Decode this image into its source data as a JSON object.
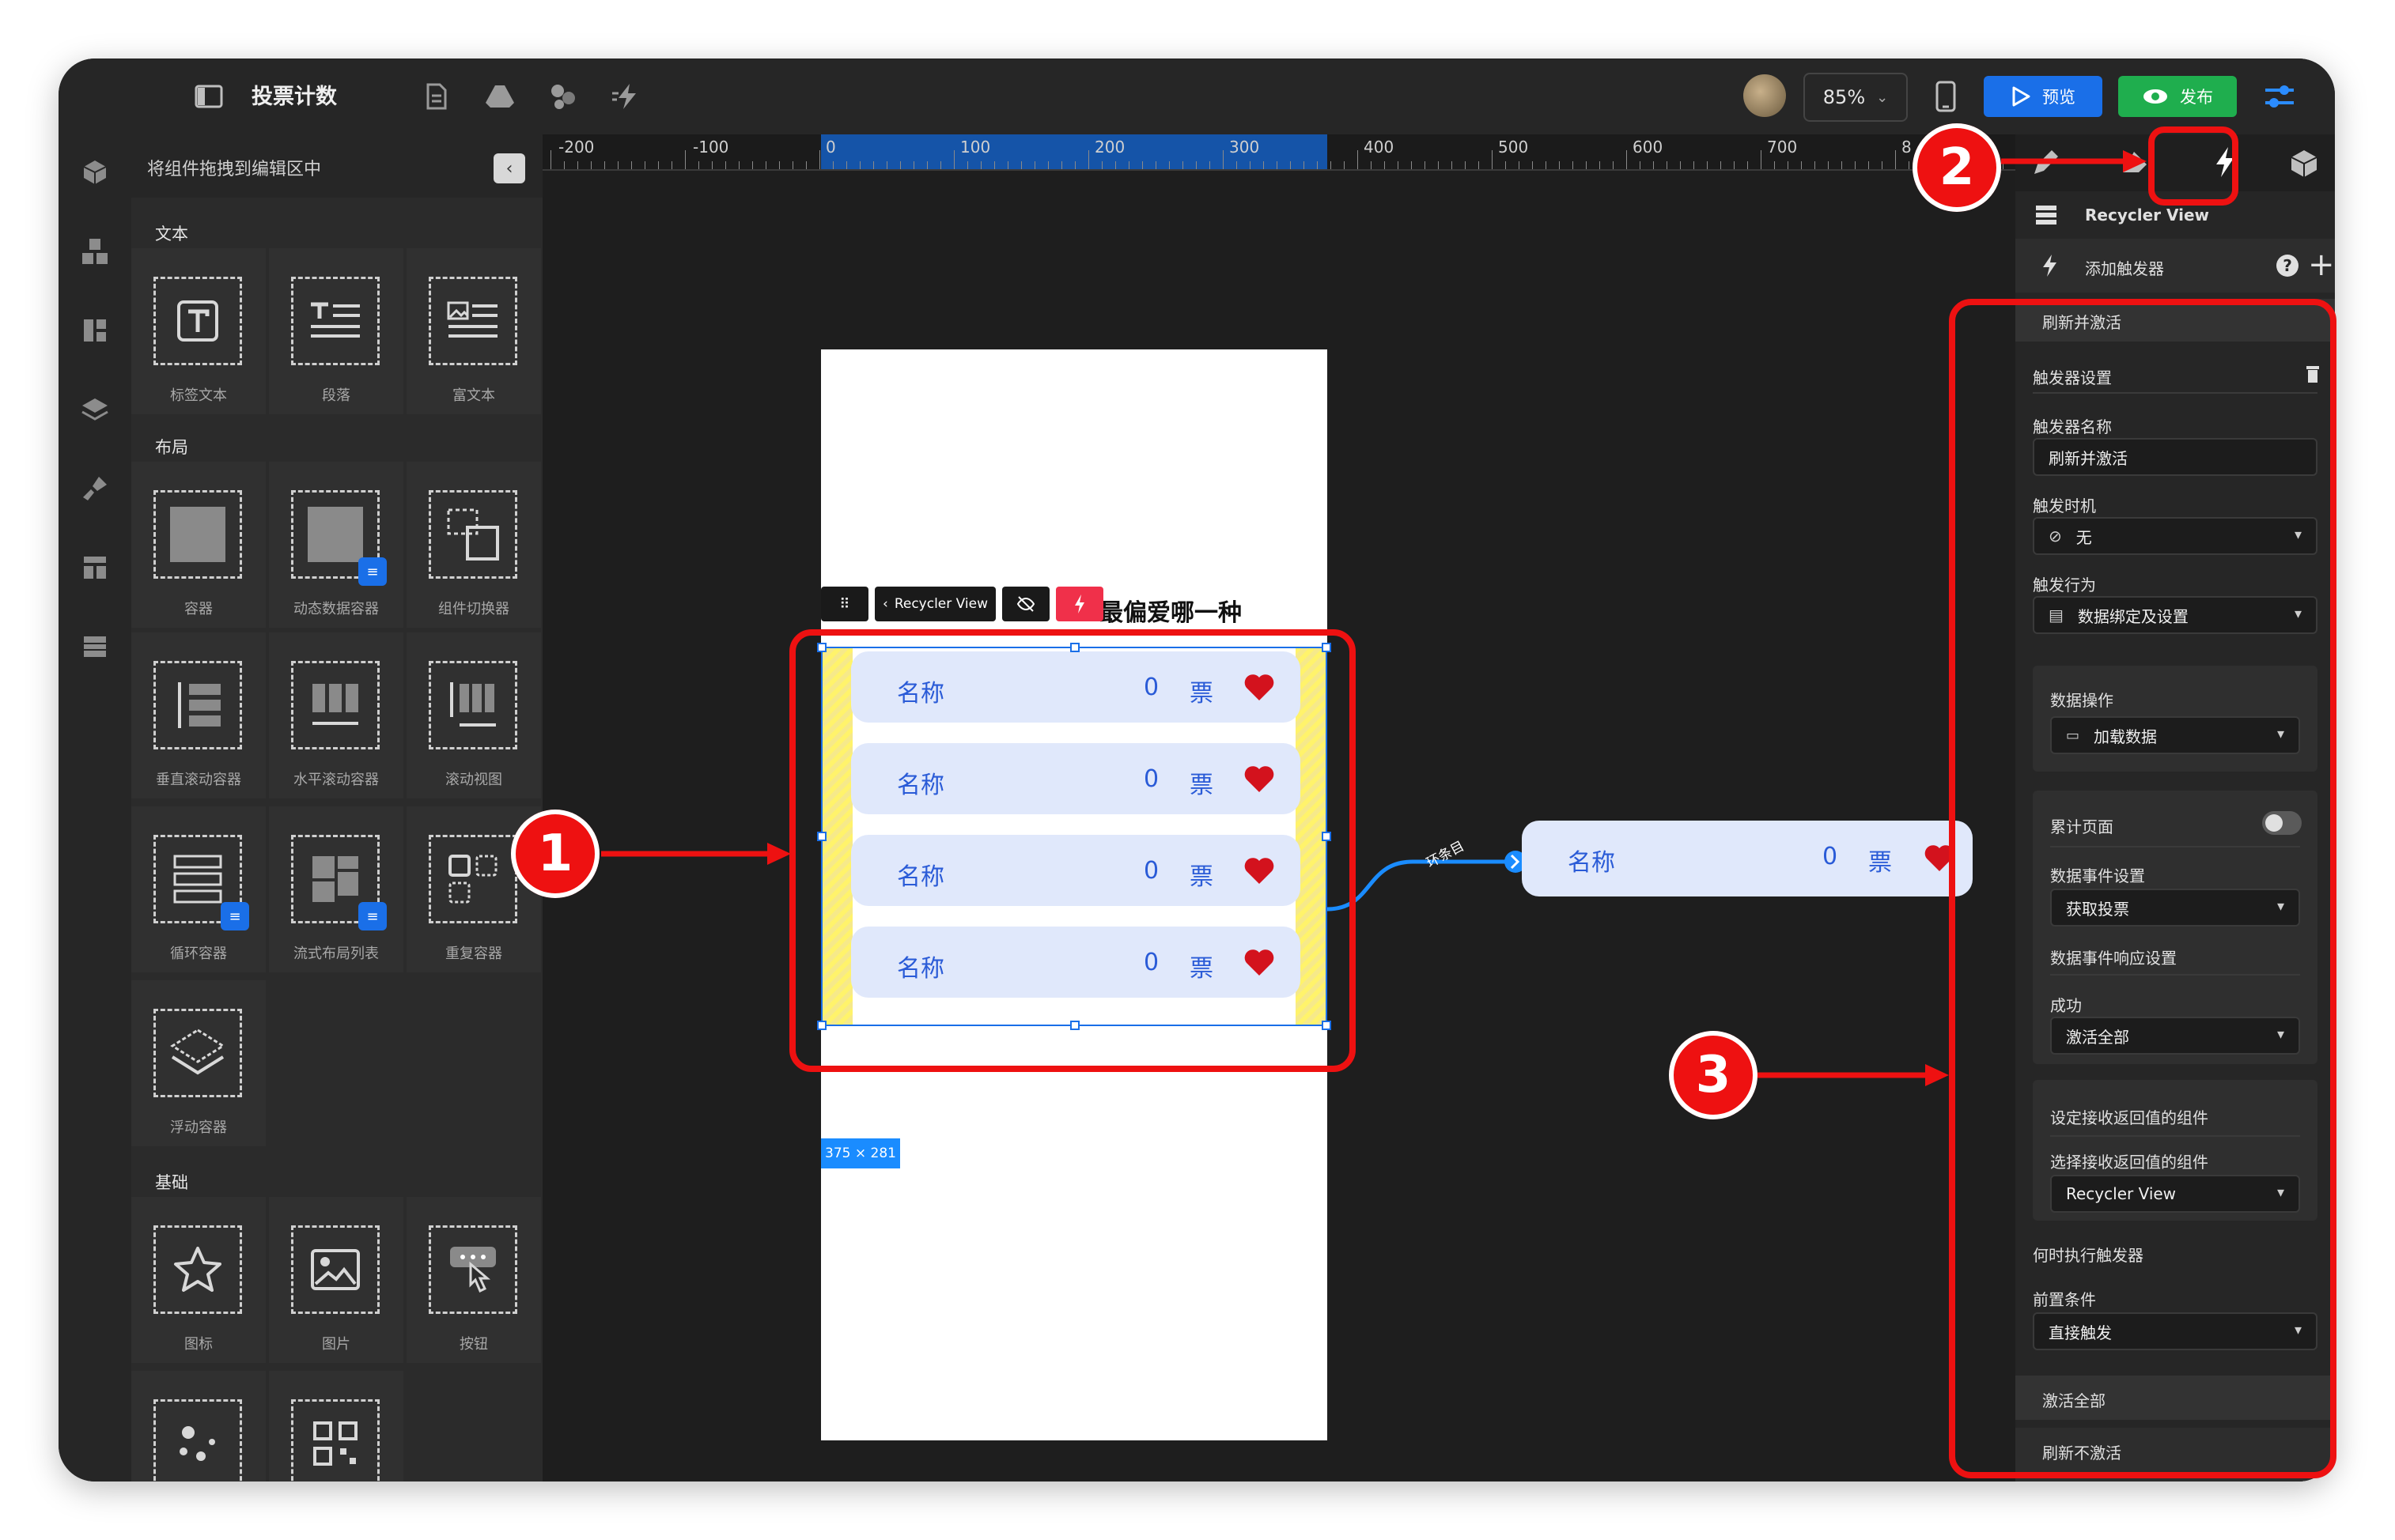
{
  "topbar": {
    "title": "投票计数",
    "zoom": "85%",
    "preview_label": "预览",
    "publish_label": "发布"
  },
  "left_panel": {
    "header": "将组件拖拽到编辑区中",
    "sections": [
      {
        "title": "文本",
        "items": [
          "标签文本",
          "段落",
          "富文本"
        ]
      },
      {
        "title": "布局",
        "items": [
          "容器",
          "动态数据容器",
          "组件切换器",
          "垂直滚动容器",
          "水平滚动容器",
          "滚动视图",
          "循环容器",
          "流式布局列表",
          "重复容器",
          "浮动容器"
        ]
      },
      {
        "title": "基础",
        "items": [
          "图标",
          "图片",
          "按钮"
        ]
      }
    ]
  },
  "ruler": {
    "labels": [
      "-200",
      "-100",
      "0",
      "100",
      "200",
      "300",
      "400",
      "500",
      "600",
      "700",
      "8"
    ]
  },
  "canvas": {
    "heading": "最偏爱哪一种",
    "toolbar_component": "Recycler View",
    "items": [
      {
        "name": "名称",
        "count": "0",
        "unit": "票"
      },
      {
        "name": "名称",
        "count": "0",
        "unit": "票"
      },
      {
        "name": "名称",
        "count": "0",
        "unit": "票"
      },
      {
        "name": "名称",
        "count": "0",
        "unit": "票"
      }
    ],
    "size_tag": "375 × 281",
    "connector_label": "环条目",
    "template": {
      "name": "名称",
      "count": "0",
      "unit": "票"
    }
  },
  "callouts": [
    "1",
    "2",
    "3"
  ],
  "right_panel": {
    "component_name": "Recycler View",
    "add_trigger": "添加触发器",
    "trigger_title": "刷新并激活",
    "trigger_settings": "触发器设置",
    "trigger_name_label": "触发器名称",
    "trigger_name_value": "刷新并激活",
    "trigger_time_label": "触发时机",
    "trigger_time_value": "无",
    "trigger_action_label": "触发行为",
    "trigger_action_value": "数据绑定及设置",
    "data_op_label": "数据操作",
    "data_op_value": "加载数据",
    "accumulate_label": "累计页面",
    "data_event_label": "数据事件设置",
    "data_event_value": "获取投票",
    "response_label": "数据事件响应设置",
    "success_label": "成功",
    "success_value": "激活全部",
    "receiver_title": "设定接收返回值的组件",
    "receiver_label": "选择接收返回值的组件",
    "receiver_value": "Recycler View",
    "when_label": "何时执行触发器",
    "precondition_label": "前置条件",
    "precondition_value": "直接触发",
    "activate_all": "激活全部",
    "refresh_no_activate": "刷新不激活"
  },
  "colors": {
    "accent": "#1a6fe8",
    "publish": "#1fae4e",
    "callout_red": "#ee1111",
    "item_bg": "#e0e8fb",
    "item_text": "#2a5bd7",
    "heart": "#d3121d"
  }
}
